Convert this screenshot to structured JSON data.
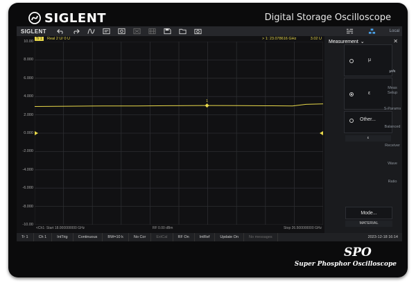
{
  "brand": {
    "name": "SIGLENT",
    "model_title": "Digital Storage Oscilloscope"
  },
  "toolbar": {
    "brand": "SIGLENT",
    "local_label": "Local",
    "icons": [
      "undo-icon",
      "redo-icon",
      "wave-measure-icon",
      "measure-table-icon",
      "cal-icon",
      "zoom-fit-icon",
      "grid-icon",
      "save-icon",
      "open-folder-icon",
      "camera-icon"
    ]
  },
  "trace": {
    "badge": "Tr 1",
    "format": "Real 2 U/ 0 U",
    "marker_readout": "> 1: 23.078616 GHz",
    "marker_value": "3.02 U",
    "marker_label": "1"
  },
  "y_axis": {
    "labels": [
      "10.00",
      "8.000",
      "6.000",
      "4.000",
      "2.000",
      "0.000",
      "-2.000",
      "-4.000",
      "-6.000",
      "-8.000",
      "-10.00"
    ]
  },
  "footer": {
    "start": "<Ch1: Start 18.000000000 GHz",
    "rf": "RF 0.00 dBm",
    "stop": "Stop 26.500000000 GHz"
  },
  "panel": {
    "title": "Measurement",
    "options": [
      {
        "label": "μ",
        "selected": false
      },
      {
        "label": "ε",
        "selected": true
      },
      {
        "label": "Other...",
        "selected": false,
        "sub": "ε"
      }
    ],
    "menu": [
      "μr/ε",
      "Meas Setup",
      "S-Params",
      "Balanced",
      "Receiver",
      "Wave",
      "Ratio"
    ],
    "mode_label": "Mode...",
    "mode_value": "MATERIAL"
  },
  "statusbar": {
    "items": [
      {
        "label": "Tr 1",
        "dim": false
      },
      {
        "label": "Ch 1",
        "dim": false
      },
      {
        "label": "IntTrig",
        "dim": false
      },
      {
        "label": "Continuous",
        "dim": false
      },
      {
        "label": "BW=10 k",
        "dim": false
      },
      {
        "label": "No Cor",
        "dim": false
      },
      {
        "label": "ExtCal",
        "dim": true
      },
      {
        "label": "RF On",
        "dim": false
      },
      {
        "label": "IntRef",
        "dim": false
      },
      {
        "label": "Update On",
        "dim": false
      },
      {
        "label": "No messages",
        "dim": true
      }
    ],
    "time": "2023-12-18 16:14"
  },
  "footer_brand": {
    "logo": "SPO",
    "caption": "Super Phosphor Oscilloscope"
  },
  "chart_data": {
    "type": "line",
    "x_range_ghz": [
      18.0,
      26.5
    ],
    "ylim": [
      -10,
      10
    ],
    "series": [
      {
        "x": [
          18.0,
          19.0,
          20.0,
          21.0,
          22.0,
          23.078616,
          24.0,
          25.0,
          25.6,
          26.0,
          26.5
        ],
        "values": [
          2.92,
          2.95,
          2.97,
          2.98,
          3.0,
          3.02,
          3.01,
          2.99,
          2.97,
          3.15,
          3.2
        ]
      }
    ],
    "reference_level": 0.0,
    "marker": {
      "x": 23.078616,
      "y": 3.02
    },
    "grid": true,
    "colors": {
      "trace": "#e8d84a",
      "grid": "#2c2d31"
    }
  },
  "colors": {
    "accent": "#e8d84a",
    "background": "#141416"
  }
}
